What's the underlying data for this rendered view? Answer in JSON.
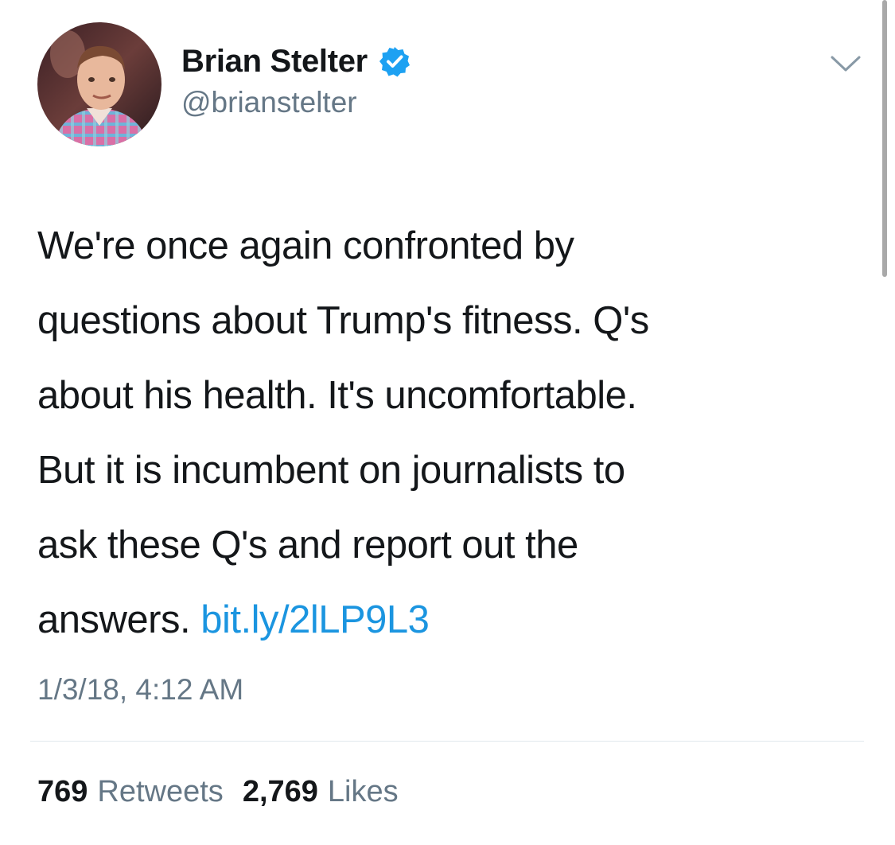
{
  "author": {
    "display_name": "Brian Stelter",
    "handle": "@brianstelter",
    "verified": true
  },
  "tweet": {
    "lines": [
      "We're once again confronted by",
      "questions about Trump's fitness. Q's",
      "about his health. It's uncomfortable.",
      "But it is incumbent on journalists to",
      "ask these Q's and report out the"
    ],
    "last_line_text": "answers.",
    "link_text": "bit.ly/2lLP9L3",
    "timestamp": "1/3/18, 4:12 AM"
  },
  "stats": {
    "retweets_count": "769",
    "retweets_label": "Retweets",
    "likes_count": "2,769",
    "likes_label": "Likes"
  },
  "icons": {
    "verified": "verified-badge-icon",
    "more": "chevron-down-icon"
  },
  "colors": {
    "text": "#14171a",
    "secondary": "#657786",
    "link": "#1b95e0",
    "verified": "#1da1f2",
    "divider": "#e1e8ed"
  }
}
